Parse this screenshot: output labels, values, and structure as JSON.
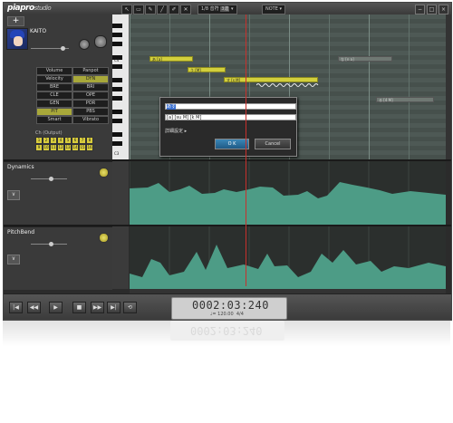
{
  "app": {
    "title_main": "piapro",
    "title_sub": "studio"
  },
  "toolbar": {
    "tools": [
      "↖",
      "▭",
      "✎",
      "╱",
      "✐",
      "✕"
    ],
    "quantize": "1/8 音符",
    "quantize_tag": "3連",
    "note_len": "NOTE",
    "win_controls": [
      "−",
      "□",
      "×"
    ]
  },
  "track": {
    "add_label": "+",
    "singer": "KAITO",
    "params": [
      {
        "left": "Volume",
        "right": "Panpot"
      },
      {
        "left": "Velocity",
        "right": "DYN"
      },
      {
        "left": "BRE",
        "right": "BRI"
      },
      {
        "left": "CLE",
        "right": "OPE"
      },
      {
        "left": "GEN",
        "right": "POR"
      },
      {
        "left": "PIT",
        "right": "PBS"
      },
      {
        "left": "Smart",
        "right": "Vibrato"
      }
    ],
    "active_params": [
      "DYN",
      "PIT"
    ],
    "channel_label": "Ch (Output)",
    "channels": [
      "1",
      "2",
      "3",
      "4",
      "5",
      "6",
      "7",
      "8",
      "9",
      "10",
      "11",
      "12",
      "13",
      "14",
      "15",
      "16"
    ]
  },
  "piano": {
    "octaves": [
      "C4",
      "C3"
    ]
  },
  "notes": [
    {
      "text": "あ [a]"
    },
    {
      "text": "う [M]"
    },
    {
      "text": "す [s M]"
    },
    {
      "text": "な [n a]"
    },
    {
      "text": "る [4 M]"
    }
  ],
  "dialog": {
    "lyric_value": "あす",
    "phoneme_value": "[a] [su M] [k M]",
    "detail_label": "詳細設定",
    "ok_label": "O K",
    "cancel_label": "Cancel"
  },
  "controllers": [
    {
      "name": "Dynamics",
      "fold": "∨"
    },
    {
      "name": "PitchBend",
      "fold": "∨"
    }
  ],
  "transport": {
    "buttons": [
      "|◀",
      "◀◀",
      "▶",
      "■",
      "▶▶",
      "▶|",
      "⟲"
    ],
    "time": "0002:03:240",
    "tempo": "♩= 120.00",
    "meter": "4/4"
  },
  "colors": {
    "note": "#d2cf3c",
    "envelope": "#4d9c86",
    "playhead": "#c8302c",
    "ok_button": "#2b77a8"
  }
}
